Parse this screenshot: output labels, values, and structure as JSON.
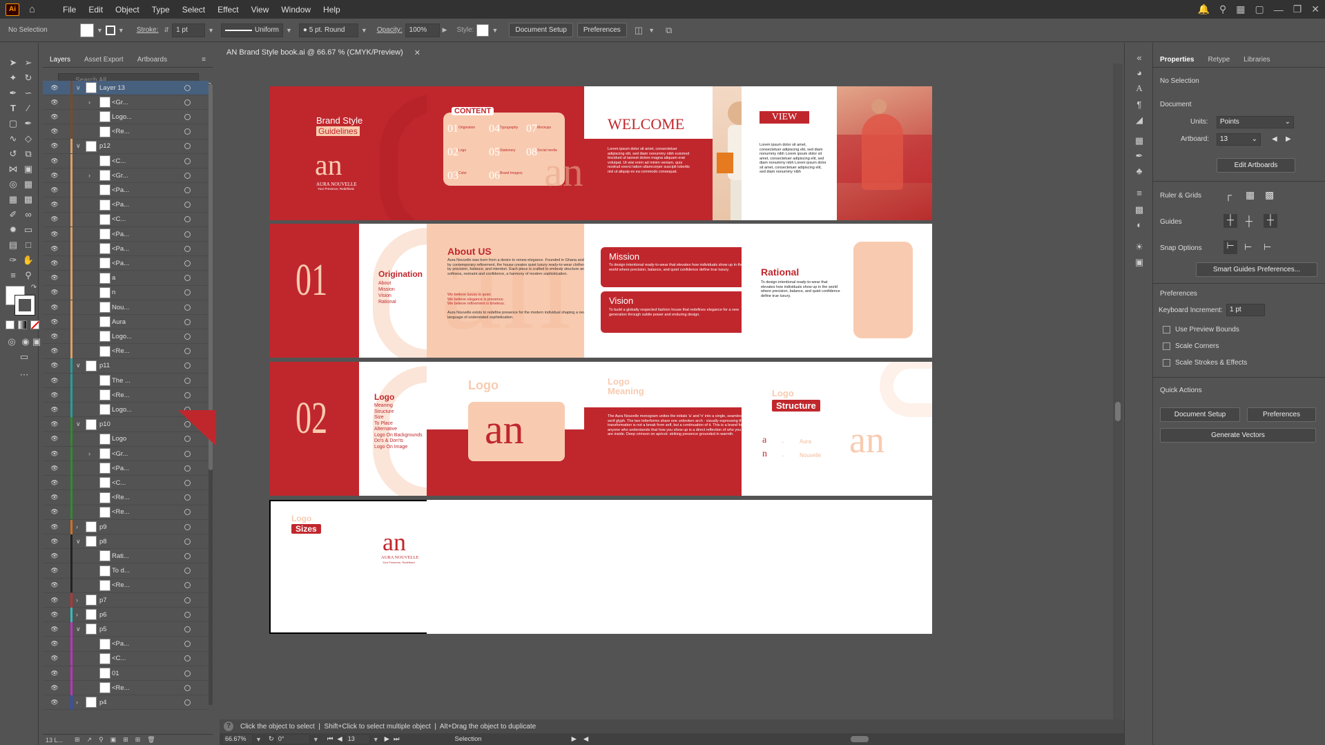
{
  "menu": {
    "app_logo": "Ai",
    "items": [
      "File",
      "Edit",
      "Object",
      "Type",
      "Select",
      "Effect",
      "View",
      "Window",
      "Help"
    ]
  },
  "control": {
    "selection": "No Selection",
    "stroke_label": "Stroke:",
    "stroke_value": "1 pt",
    "uniform": "Uniform",
    "brush": "5 pt. Round",
    "opacity_label": "Opacity:",
    "opacity_value": "100%",
    "style_label": "Style:",
    "doc_setup": "Document Setup",
    "preferences": "Preferences"
  },
  "layers_panel": {
    "tabs": [
      "Layers",
      "Asset Export",
      "Artboards"
    ],
    "search_placeholder": "Search All",
    "rows": [
      {
        "name": "Layer 13",
        "indent": 0,
        "exp": "v",
        "color": "#7a4a2a",
        "sel": true
      },
      {
        "name": "<Gr...",
        "indent": 1,
        "exp": ">",
        "color": "#7a4a2a"
      },
      {
        "name": "Logo...",
        "indent": 1,
        "exp": "",
        "color": "#7a4a2a"
      },
      {
        "name": "<Re...",
        "indent": 1,
        "exp": "",
        "color": "#7a4a2a"
      },
      {
        "name": "p12",
        "indent": 0,
        "exp": "v",
        "color": "#e0a060"
      },
      {
        "name": "<C...",
        "indent": 1,
        "exp": "",
        "color": "#e0a060"
      },
      {
        "name": "<Gr...",
        "indent": 1,
        "exp": ">",
        "color": "#e0a060"
      },
      {
        "name": "<Pa...",
        "indent": 1,
        "exp": "",
        "color": "#e0a060"
      },
      {
        "name": "<Pa...",
        "indent": 1,
        "exp": "",
        "color": "#e0a060"
      },
      {
        "name": "<C...",
        "indent": 1,
        "exp": "",
        "color": "#e0a060"
      },
      {
        "name": "<Pa...",
        "indent": 1,
        "exp": "",
        "color": "#e0a060"
      },
      {
        "name": "<Pa...",
        "indent": 1,
        "exp": "",
        "color": "#e0a060"
      },
      {
        "name": "<Pa...",
        "indent": 1,
        "exp": "",
        "color": "#e0a060"
      },
      {
        "name": "a",
        "indent": 1,
        "exp": "",
        "color": "#e0a060"
      },
      {
        "name": "n",
        "indent": 1,
        "exp": "",
        "color": "#e0a060"
      },
      {
        "name": "Nou...",
        "indent": 1,
        "exp": "",
        "color": "#e0a060"
      },
      {
        "name": "Aura",
        "indent": 1,
        "exp": "",
        "color": "#e0a060"
      },
      {
        "name": "Logo...",
        "indent": 1,
        "exp": "",
        "color": "#e0a060"
      },
      {
        "name": "<Re...",
        "indent": 1,
        "exp": "",
        "color": "#e0a060"
      },
      {
        "name": "p11",
        "indent": 0,
        "exp": "v",
        "color": "#20a0a0"
      },
      {
        "name": "The ...",
        "indent": 1,
        "exp": "",
        "color": "#20a0a0"
      },
      {
        "name": "<Re...",
        "indent": 1,
        "exp": "",
        "color": "#20a0a0"
      },
      {
        "name": "Logo...",
        "indent": 1,
        "exp": "",
        "color": "#20a0a0"
      },
      {
        "name": "p10",
        "indent": 0,
        "exp": "v",
        "color": "#2d8c2d"
      },
      {
        "name": "Logo",
        "indent": 1,
        "exp": "",
        "color": "#2d8c2d"
      },
      {
        "name": "<Gr...",
        "indent": 1,
        "exp": ">",
        "color": "#2d8c2d"
      },
      {
        "name": "<Pa...",
        "indent": 1,
        "exp": "",
        "color": "#2d8c2d"
      },
      {
        "name": "<C...",
        "indent": 1,
        "exp": "",
        "color": "#2d8c2d"
      },
      {
        "name": "<Re...",
        "indent": 1,
        "exp": "",
        "color": "#2d8c2d"
      },
      {
        "name": "<Re...",
        "indent": 1,
        "exp": "",
        "color": "#2d8c2d"
      },
      {
        "name": "p9",
        "indent": 0,
        "exp": ">",
        "color": "#d07020"
      },
      {
        "name": "p8",
        "indent": 0,
        "exp": "v",
        "color": "#222222"
      },
      {
        "name": "Rati...",
        "indent": 1,
        "exp": "",
        "color": "#222222"
      },
      {
        "name": "To d...",
        "indent": 1,
        "exp": "",
        "color": "#222222"
      },
      {
        "name": "<Re...",
        "indent": 1,
        "exp": "",
        "color": "#222222"
      },
      {
        "name": "p7",
        "indent": 0,
        "exp": ">",
        "color": "#c03030"
      },
      {
        "name": "p6",
        "indent": 0,
        "exp": ">",
        "color": "#30c0c0"
      },
      {
        "name": "p5",
        "indent": 0,
        "exp": "v",
        "color": "#c030c0"
      },
      {
        "name": "<Pa...",
        "indent": 1,
        "exp": "",
        "color": "#c030c0"
      },
      {
        "name": "<C...",
        "indent": 1,
        "exp": "",
        "color": "#c030c0"
      },
      {
        "name": "01",
        "indent": 1,
        "exp": "",
        "color": "#c030c0"
      },
      {
        "name": "<Re...",
        "indent": 1,
        "exp": "",
        "color": "#c030c0"
      },
      {
        "name": "p4",
        "indent": 0,
        "exp": ">",
        "color": "#3050c0"
      }
    ],
    "footer_count": "13 L..."
  },
  "document": {
    "tab_title": "AN Brand Style book.ai @ 66.67 % (CMYK/Preview)"
  },
  "artboards": {
    "a1": {
      "title1": "Brand Style",
      "title2": "Guidelines",
      "brand": "AURA NOUVELLE",
      "tagline": "Your Presence, Redefined."
    },
    "a2": {
      "heading": "CONTENT",
      "n1": "01",
      "n2": "02",
      "n3": "03",
      "n4": "04",
      "n5": "05",
      "n6": "06",
      "n7": "07",
      "n8": "08",
      "c1": "Origination",
      "c2": "Logo",
      "c3": "Color",
      "c4": "Typography",
      "c5": "Stationery",
      "c6": "Brand Imagery",
      "c7": "Mockups",
      "c8": "Social media"
    },
    "a3": {
      "title": "WELCOME",
      "body": "Lorem ipsum dolor sit amet, consectetuer adipiscing elit, sed diam nonummy nibh euismod tincidunt ut laoreet dolore magna aliquam erat volutpat. Ut wisi enim ad minim veniam, quis nostrud exerci tation ullamcorper suscipit lobortis nisl ut aliquip ex ea commodo consequat."
    },
    "a4": {
      "title": "VIEW",
      "body": "Lorem ipsum dolor sit amet, consectetuer adipiscing elit, sed diam nonummy nibh Lorem ipsum dolor sit amet, consectetuer adipiscing elit, sed diam nonummy nibh Lorem ipsum dolor sit amet, consectetuer adipiscing elit, sed diam nonummy nibh"
    },
    "a5": {
      "num": "01",
      "title": "Origination",
      "i1": "About",
      "i2": "Mission",
      "i3": "Vision",
      "i4": "Rational"
    },
    "a6": {
      "title": "About US",
      "p1": "Aura Nouvelle was born from a desire to renew elegance. Founded in Ghana and shaped by contemporary refinement, the house creates quiet luxury ready-to-wear clothes defined by precision, balance, and intention. Each piece is crafted to embody structure and softness, restraint and confidence, a harmony of modern sophistication.",
      "p2a": "We believe luxury is quiet.",
      "p2b": "We believe elegance is presence.",
      "p2c": "We believe refinement is timeless.",
      "p3": "Aura Nouvelle exists to redefine presence for the modern individual shaping a new language of understated sophistication."
    },
    "a7": {
      "t1": "Mission",
      "b1": "To design intentional ready-to-wear that elevates how individuals show up in the world where precision, balance, and quiet confidence define true luxury.",
      "t2": "Vision",
      "b2": "To build a globally respected fashion house that redefines elegance for a new generation through subtle power and enduring design."
    },
    "a8": {
      "title": "Rational",
      "body": "To design intentional ready-to-wear that elevates how individuals show up in the world where precision, balance, and quiet confidence define true luxury."
    },
    "a9": {
      "num": "02",
      "title": "Logo",
      "i1": "Meaning",
      "i2": "Structure",
      "i3": "Size",
      "i4": "To Place",
      "i5": "Alternative",
      "i6": "Logo On Backgrounds",
      "i7": "Do's & Don'ts",
      "i8": "Logo On Image"
    },
    "a10": {
      "title": "Logo"
    },
    "a11": {
      "t1": "Logo",
      "t2": "Meaning",
      "body": "The Aura Nouvelle monogram unites the initials 'a' and 'n' into a single, seamless serif glyph. The two letterforms share one unbroken arch - visually expressing that transformation is not a break from self, but a continuation of it. This is a brand for anyone who understands that how you show up is a direct reflection of who you are inside. Deep crimson on apricot: striking presence grounded in warmth."
    },
    "a12": {
      "t1": "Logo",
      "t2": "Structure",
      "a": "a",
      "n": "n",
      "dash": "-",
      "aura": "Aura",
      "nouvelle": "Nouvelle"
    },
    "a13": {
      "t1": "Logo",
      "t2": "Sizes",
      "brand": "AURA NOUVELLE",
      "tagline": "Your Presence, Redefined."
    },
    "monogram": "an"
  },
  "status": {
    "help": "?",
    "hint": "Click the object to select  |  Shift+Click to select multiple object  |  Alt+Drag the object to duplicate"
  },
  "bottom": {
    "zoom": "66.67%",
    "rotate": "0°",
    "artboard": "13",
    "tool": "Selection"
  },
  "properties": {
    "tabs": [
      "Properties",
      "Retype",
      "Libraries"
    ],
    "no_selection": "No Selection",
    "document_label": "Document",
    "units_label": "Units:",
    "units_value": "Points",
    "artboard_label": "Artboard:",
    "artboard_value": "13",
    "edit_artboards": "Edit Artboards",
    "ruler_grids": "Ruler & Grids",
    "guides": "Guides",
    "snap_options": "Snap Options",
    "smart_guides": "Smart Guides Preferences...",
    "preferences_label": "Preferences",
    "keyboard_inc_label": "Keyboard Increment:",
    "keyboard_inc_value": "1 pt",
    "chk1": "Use Preview Bounds",
    "chk2": "Scale Corners",
    "chk3": "Scale Strokes & Effects",
    "quick_actions": "Quick Actions",
    "qa_doc_setup": "Document Setup",
    "qa_prefs": "Preferences",
    "generate_vectors": "Generate Vectors"
  },
  "colors": {
    "brand_red": "#c0272d",
    "peach": "#f8cbb0",
    "ui_bg": "#535353",
    "ui_dark": "#323232",
    "selection": "#46607e"
  }
}
